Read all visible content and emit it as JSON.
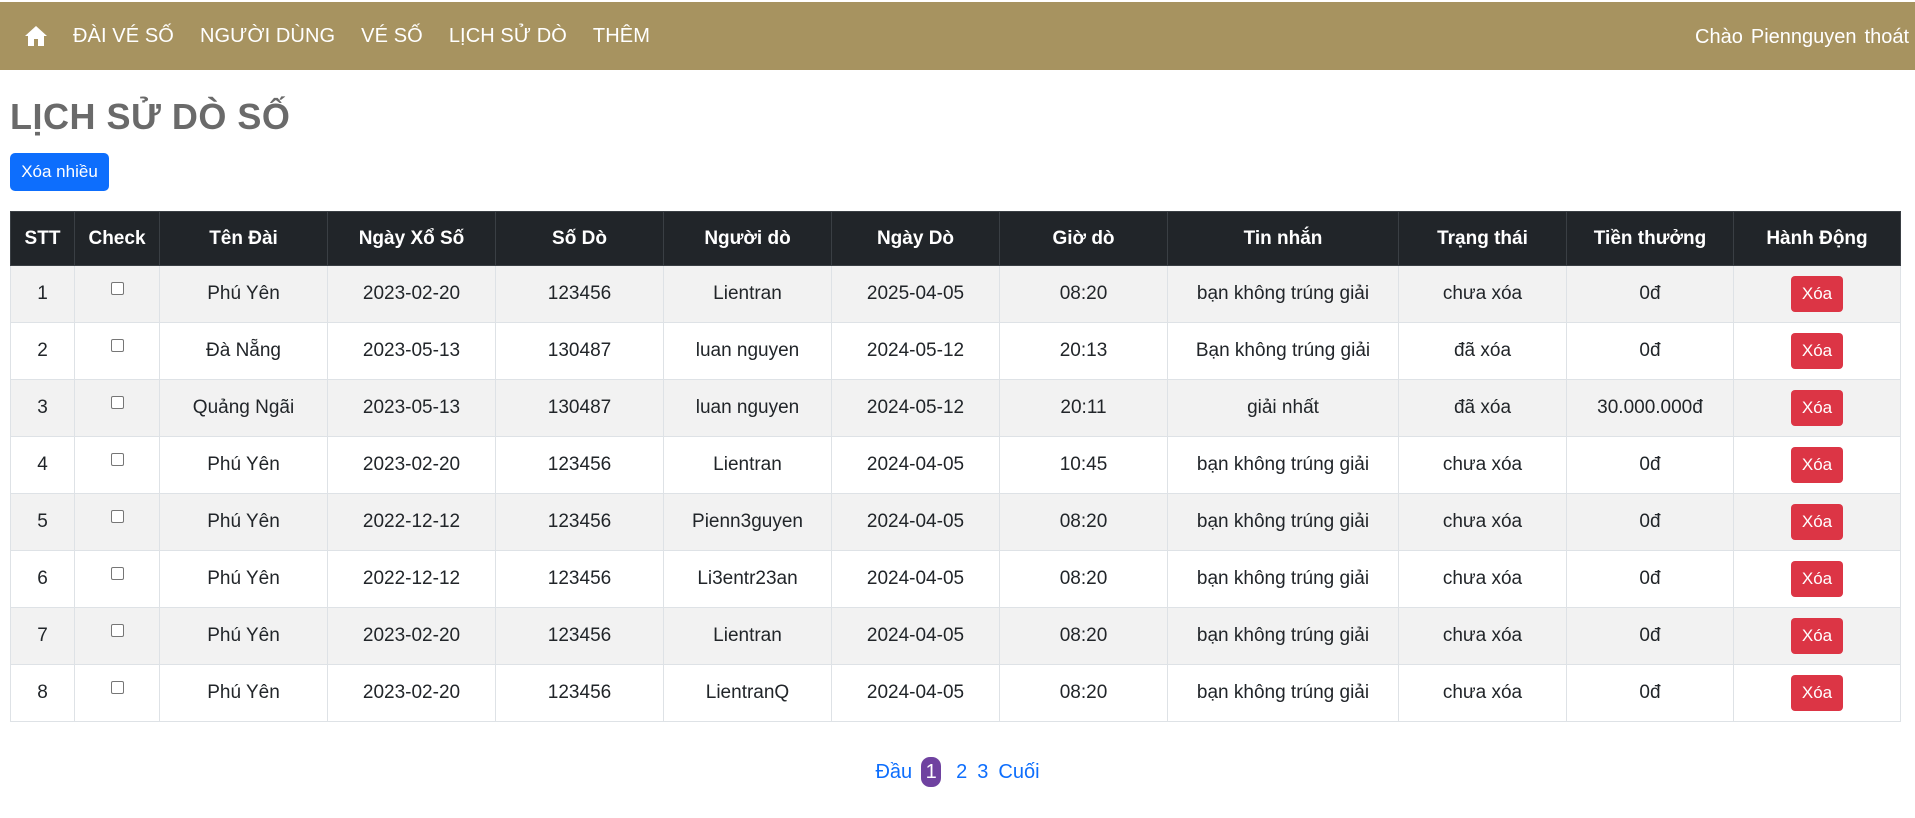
{
  "nav": {
    "items": [
      "ĐÀI VÉ SỐ",
      "NGƯỜI DÙNG",
      "VÉ SỐ",
      "LỊCH SỬ DÒ",
      "THÊM"
    ],
    "greeting": "Chào",
    "username": "Piennguyen",
    "logout": "thoát",
    "bg_color": "#a79360"
  },
  "page": {
    "title": "LỊCH SỬ DÒ SỐ",
    "bulk_delete": "Xóa nhiều"
  },
  "table": {
    "headers": [
      "STT",
      "Check",
      "Tên Đài",
      "Ngày Xổ Số",
      "Số Dò",
      "Người dò",
      "Ngày Dò",
      "Giờ dò",
      "Tin nhắn",
      "Trạng thái",
      "Tiền thưởng",
      "Hành Động"
    ],
    "delete_label": "Xóa",
    "rows": [
      [
        "1",
        "Phú Yên",
        "2023-02-20",
        "123456",
        "Lientran",
        "2025-04-05",
        "08:20",
        "bạn không trúng giải",
        "chưa xóa",
        "0đ"
      ],
      [
        "2",
        "Đà Nẵng",
        "2023-05-13",
        "130487",
        "luan nguyen",
        "2024-05-12",
        "20:13",
        "Bạn không trúng giải",
        "đã xóa",
        "0đ"
      ],
      [
        "3",
        "Quảng Ngãi",
        "2023-05-13",
        "130487",
        "luan nguyen",
        "2024-05-12",
        "20:11",
        "giải nhất",
        "đã xóa",
        "30.000.000đ"
      ],
      [
        "4",
        "Phú Yên",
        "2023-02-20",
        "123456",
        "Lientran",
        "2024-04-05",
        "10:45",
        "bạn không trúng giải",
        "chưa xóa",
        "0đ"
      ],
      [
        "5",
        "Phú Yên",
        "2022-12-12",
        "123456",
        "Pienn3guyen",
        "2024-04-05",
        "08:20",
        "bạn không trúng giải",
        "chưa xóa",
        "0đ"
      ],
      [
        "6",
        "Phú Yên",
        "2022-12-12",
        "123456",
        "Li3entr23an",
        "2024-04-05",
        "08:20",
        "bạn không trúng giải",
        "chưa xóa",
        "0đ"
      ],
      [
        "7",
        "Phú Yên",
        "2023-02-20",
        "123456",
        "Lientran",
        "2024-04-05",
        "08:20",
        "bạn không trúng giải",
        "chưa xóa",
        "0đ"
      ],
      [
        "8",
        "Phú Yên",
        "2023-02-20",
        "123456",
        "LientranQ",
        "2024-04-05",
        "08:20",
        "bạn không trúng giải",
        "chưa xóa",
        "0đ"
      ]
    ]
  },
  "pagination": {
    "first": "Đầu",
    "pages": [
      "1",
      "2",
      "3"
    ],
    "current": "1",
    "last": "Cuối"
  },
  "icons": {
    "home": "home-icon"
  }
}
